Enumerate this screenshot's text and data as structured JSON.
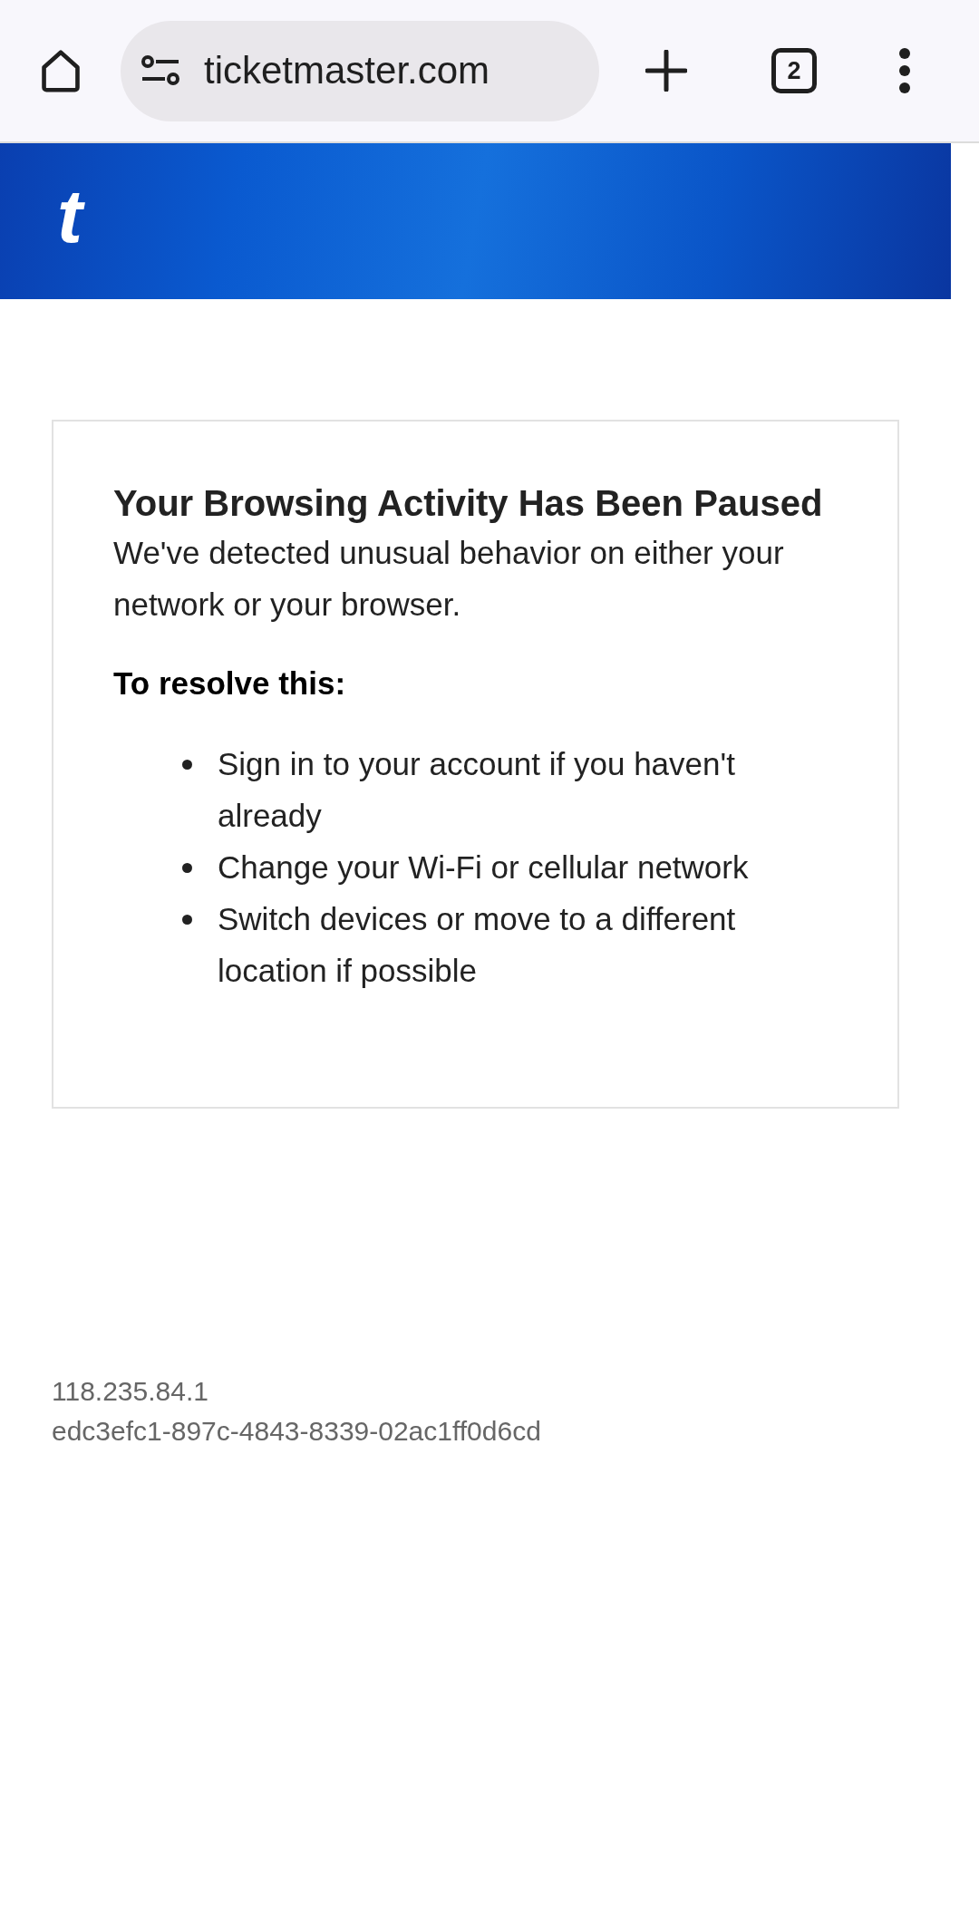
{
  "browser": {
    "url": "ticketmaster.com",
    "tab_count": "2"
  },
  "header": {
    "logo": "t"
  },
  "notice": {
    "title": "Your Browsing Activity Has Been Paused",
    "message": "We've detected unusual behavior on either your network or your browser.",
    "resolve_heading": "To resolve this:",
    "steps": [
      "Sign in to your account if you haven't already",
      "Change your Wi-Fi or cellular network",
      "Switch devices or move to a different location if possible"
    ]
  },
  "footer": {
    "ip": "118.235.84.1",
    "request_id": "edc3efc1-897c-4843-8339-02ac1ff0d6cd"
  }
}
